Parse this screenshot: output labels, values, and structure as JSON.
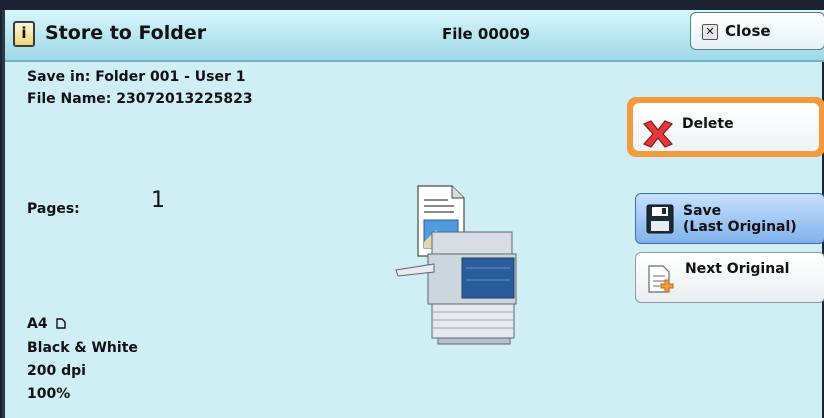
{
  "header": {
    "title": "Store to Folder",
    "file_label": "File 00009",
    "close_label": "Close"
  },
  "details": {
    "save_in": "Save in: Folder 001 - User 1",
    "file_name": "File Name: 23072013225823",
    "pages_label": "Pages:",
    "pages_value": "1",
    "paper_size": "A4",
    "color_mode": "Black & White",
    "resolution": "200 dpi",
    "zoom": "100%"
  },
  "buttons": {
    "delete": "Delete",
    "save_line1": "Save",
    "save_line2": "(Last Original)",
    "next_original": "Next Original"
  },
  "icons": [
    "info-icon",
    "close-x-icon",
    "delete-x-icon",
    "save-disk-icon",
    "next-original-icon",
    "portrait-paper-icon",
    "printer-illustration"
  ],
  "colors": {
    "panel_bg": "#cfeff5",
    "selected_outline": "#f39a3a",
    "save_button": "#7fb2ea"
  }
}
